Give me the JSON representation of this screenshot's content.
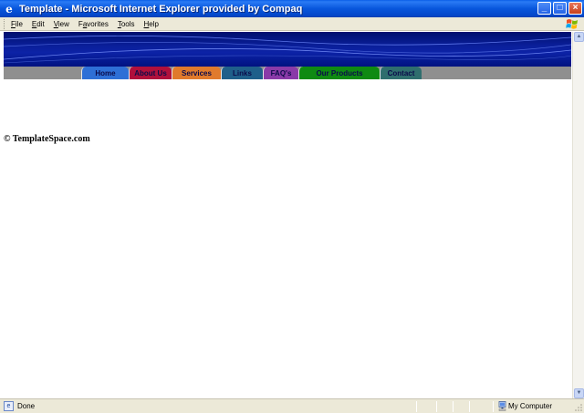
{
  "window": {
    "title": "Template - Microsoft Internet Explorer provided by Compaq",
    "icon": "ie-icon",
    "buttons": {
      "minimize": "_",
      "maximize": "□",
      "close": "×"
    }
  },
  "menu": {
    "items": [
      {
        "label": "File",
        "key": "F",
        "rest": "ile"
      },
      {
        "label": "Edit",
        "key": "E",
        "rest": "dit"
      },
      {
        "label": "View",
        "key": "V",
        "rest": "iew"
      },
      {
        "label": "Favorites",
        "key": "a",
        "pre": "F",
        "rest": "vorites"
      },
      {
        "label": "Tools",
        "key": "T",
        "rest": "ools"
      },
      {
        "label": "Help",
        "key": "H",
        "rest": "elp"
      }
    ]
  },
  "site": {
    "nav": [
      {
        "label": "Home",
        "color": "#2e6fd6"
      },
      {
        "label": "About Us",
        "color": "#b0103c"
      },
      {
        "label": "Services",
        "color": "#e07a2c"
      },
      {
        "label": "Links",
        "color": "#1f5f8a"
      },
      {
        "label": "FAQ's",
        "color": "#8a3aa8"
      },
      {
        "label": "Our Products",
        "color": "#0f8a12"
      },
      {
        "label": "Contact",
        "color": "#2f6e6e"
      }
    ],
    "copyright": "© TemplateSpace.com",
    "banner_color": "#0c22a6"
  },
  "status": {
    "text": "Done",
    "zone": "My Computer"
  }
}
